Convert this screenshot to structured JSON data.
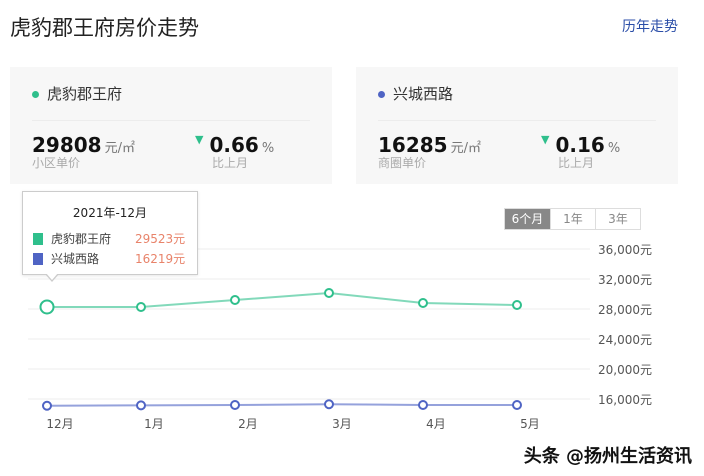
{
  "header": {
    "title": "虎豹郡王府房价走势",
    "history_link": "历年走势"
  },
  "cards": [
    {
      "name": "虎豹郡王府",
      "color": "#2fbf8c",
      "price": "29808",
      "unit": "元/㎡",
      "price_label": "小区单价",
      "change": "0.66",
      "change_unit": "%",
      "change_label": "比上月"
    },
    {
      "name": "兴城西路",
      "color": "#4f64c4",
      "price": "16285",
      "unit": "元/㎡",
      "price_label": "商圈单价",
      "change": "0.16",
      "change_unit": "%",
      "change_label": "比上月"
    }
  ],
  "range_tabs": [
    "6个月",
    "1年",
    "3年"
  ],
  "tooltip": {
    "title": "2021年-12月",
    "rows": [
      {
        "name": "虎豹郡王府",
        "value": "29523元",
        "color": "#2fbf8c"
      },
      {
        "name": "兴城西路",
        "value": "16219元",
        "color": "#4f64c4"
      }
    ]
  },
  "chart_data": {
    "type": "line",
    "categories": [
      "12月",
      "1月",
      "2月",
      "3月",
      "4月",
      "5月"
    ],
    "yticks": [
      "36,000元",
      "32,000元",
      "28,000元",
      "24,000元",
      "20,000元",
      "16,000元"
    ],
    "ytick_values": [
      36000,
      32000,
      28000,
      24000,
      20000,
      16000
    ],
    "series": [
      {
        "name": "虎豹郡王府",
        "color": "#2fbf8c",
        "values": [
          28270,
          28270,
          29200,
          30130,
          28800,
          28530
        ]
      },
      {
        "name": "兴城西路",
        "color": "#4f64c4",
        "values": [
          15100,
          15150,
          15200,
          15300,
          15200,
          15200
        ]
      }
    ]
  },
  "watermark": "头条 @扬州生活资讯"
}
